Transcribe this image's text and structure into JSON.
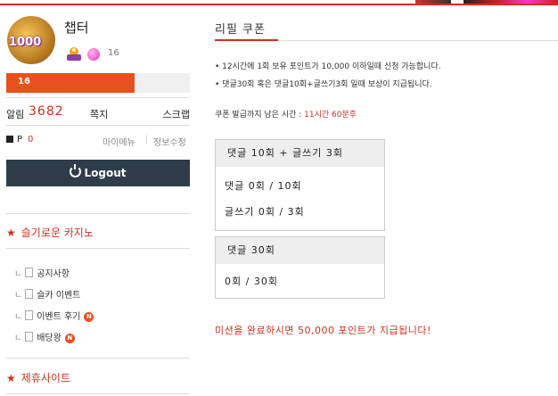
{
  "colors": {
    "accent": "#d0301f",
    "exp_fill": "#e8501e",
    "logout_bg": "#2f3d4a",
    "box_header": "#eeeeee"
  },
  "user": {
    "nickname": "챕터",
    "avatar_badge": "1000",
    "level": "16",
    "exp_level_label": "16",
    "exp_fraction": 0.7
  },
  "stats": {
    "alarm_label": "알림",
    "alarm_count": "3682",
    "message_label": "쪽지",
    "scrap_label": "스크랩"
  },
  "points": {
    "label": "P",
    "value": "0",
    "my_menu": "마이메뉴",
    "divider": "|",
    "edit_info": "정보수정"
  },
  "logout_label": "Logout",
  "sidebar": {
    "category1": {
      "star": "★",
      "title": "슬기로운 카지노"
    },
    "items": [
      {
        "tree": "ㄴ",
        "label": "공지사항",
        "new": ""
      },
      {
        "tree": "ㄴ",
        "label": "슬카 이벤트",
        "new": ""
      },
      {
        "tree": "ㄴ",
        "label": "이벤트 후기",
        "new": "N"
      },
      {
        "tree": "ㄴ",
        "label": "배당왕",
        "new": "N"
      }
    ],
    "category2": {
      "star": "★",
      "title": "제휴사이트"
    }
  },
  "main": {
    "title": "리필 쿠폰",
    "notes": [
      "• 12시간에 1회 보유 포인트가 10,000 이하일때 신청 가능합니다.",
      "• 댓글30회 혹은 댓글10회+글쓰기3회 일때 보상이 지급됩니다."
    ],
    "timer_label": "쿠폰 발급까지 남은 시간 : ",
    "timer_value": "11시간 60분후",
    "box1": {
      "header": "댓글 10회 + 글쓰기 3회",
      "rows": [
        "댓글 0회 / 10회",
        "글쓰기 0회 / 3회"
      ]
    },
    "box2": {
      "header": "댓글 30회",
      "rows": [
        "0회 / 30회"
      ]
    },
    "final_message": "미션을 완료하시면 50,000 포인트가 지급됩니다!"
  }
}
